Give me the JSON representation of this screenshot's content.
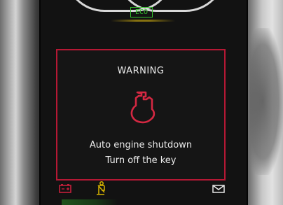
{
  "status_bar": {
    "eco_label": "ECO"
  },
  "warning": {
    "title": "WARNING",
    "icon": "engine-oil-warning-icon",
    "line1": "Auto engine shutdown",
    "line2": "Turn off the key"
  },
  "bottom_icons": [
    "battery-icon",
    "seatbelt-icon",
    "message-icon"
  ],
  "colors": {
    "warning_red": "#b51834",
    "eco_green": "#37c22e",
    "seatbelt_amber": "#d7b400",
    "text_white": "#ececec"
  }
}
